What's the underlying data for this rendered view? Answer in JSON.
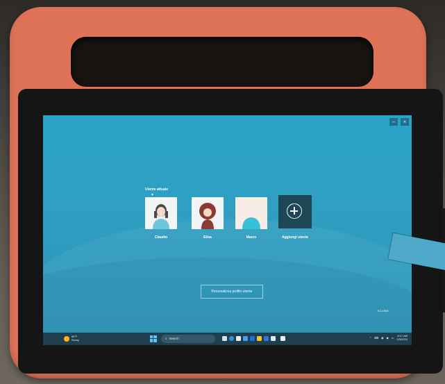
{
  "screen": {
    "current_user_label": "Utente attuale",
    "users": [
      {
        "name": "Claudio",
        "avatar": "man-avatar"
      },
      {
        "name": "Elisa",
        "avatar": "woman-avatar"
      },
      {
        "name": "Marco",
        "avatar": "person-avatar"
      }
    ],
    "add_user_label": "Aggiungi utente",
    "customize_button": "Personalizza profilo utente",
    "version_label": "9.2.1906",
    "window_controls": {
      "minimize": "–",
      "close": "×"
    }
  },
  "taskbar": {
    "weather_temp": "60°F",
    "weather_condition": "Sunny",
    "search_placeholder": "Search",
    "time": "8:17 AM",
    "date": "2/3/2024"
  },
  "colors": {
    "case": "#df7358",
    "screen": "#2aa3c7",
    "taskbar": "#1f3f4f",
    "add_tile": "#1f4655"
  }
}
